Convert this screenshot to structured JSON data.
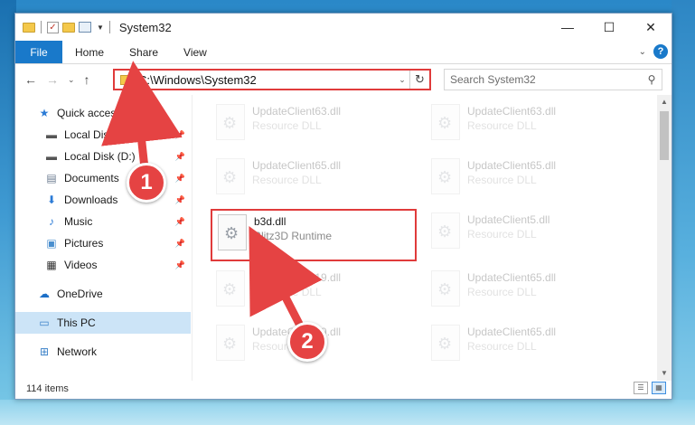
{
  "window": {
    "title": "System32",
    "controls": {
      "minimize": "—",
      "maximize": "☐",
      "close": "✕"
    }
  },
  "ribbon": {
    "tabs": [
      "File",
      "Home",
      "Share",
      "View"
    ],
    "help": "?"
  },
  "address": {
    "path": "C:\\Windows\\System32",
    "search_placeholder": "Search System32"
  },
  "sidebar": {
    "items": [
      {
        "label": "Quick access",
        "icon": "star-icon"
      },
      {
        "label": "Local Disk (C:)",
        "icon": "drive-icon",
        "pinned": true
      },
      {
        "label": "Local Disk (D:)",
        "icon": "drive-icon",
        "pinned": true
      },
      {
        "label": "Documents",
        "icon": "documents-icon",
        "pinned": true
      },
      {
        "label": "Downloads",
        "icon": "download-icon",
        "pinned": true
      },
      {
        "label": "Music",
        "icon": "music-icon",
        "pinned": true
      },
      {
        "label": "Pictures",
        "icon": "pictures-icon",
        "pinned": true
      },
      {
        "label": "Videos",
        "icon": "videos-icon",
        "pinned": true
      },
      {
        "label": "OneDrive",
        "icon": "cloud-icon"
      },
      {
        "label": "This PC",
        "icon": "computer-icon",
        "selected": true
      },
      {
        "label": "Network",
        "icon": "network-icon"
      }
    ]
  },
  "files": [
    {
      "name": "UpdateClient63.dll",
      "desc": "Resource DLL"
    },
    {
      "name": "UpdateClient63.dll",
      "desc": "Resource DLL"
    },
    {
      "name": "UpdateClient65.dll",
      "desc": "Resource DLL"
    },
    {
      "name": "UpdateClient65.dll",
      "desc": "Resource DLL"
    },
    {
      "name": "b3d.dll",
      "desc": "Blitz3D Runtime",
      "highlighted": true
    },
    {
      "name": "UpdateClient5.dll",
      "desc": "Resource DLL"
    },
    {
      "name": "UpdateClient19.dll",
      "desc": "Resource DLL"
    },
    {
      "name": "UpdateClient65.dll",
      "desc": "Resource DLL"
    },
    {
      "name": "UpdateClient19.dll",
      "desc": "Resource DLL"
    },
    {
      "name": "UpdateClient65.dll",
      "desc": "Resource DLL"
    }
  ],
  "status": {
    "count": "114 items"
  },
  "annotations": {
    "step1": "1",
    "step2": "2"
  },
  "colors": {
    "accent": "#1979ca",
    "highlight": "#e03b3b"
  }
}
